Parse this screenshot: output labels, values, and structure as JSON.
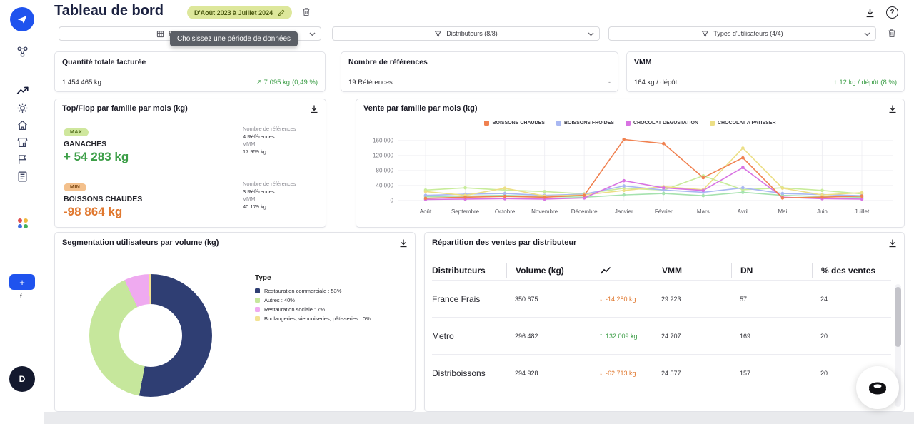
{
  "header": {
    "title": "Tableau de bord",
    "period_badge": "D'Août 2023 à Juillet 2024",
    "help_label": "?"
  },
  "tooltip": "Choisissez une période de données",
  "filters": [
    {
      "label": "Références (19/19)"
    },
    {
      "label": "Distributeurs (8/8)"
    },
    {
      "label": "Types d'utilisateurs (4/4)"
    }
  ],
  "kpis": [
    {
      "title": "Quantité totale facturée",
      "value": "1 454 465 kg",
      "delta_arrow": "↗",
      "delta": "7 095 kg",
      "pct": "(0,49 %)"
    },
    {
      "title": "Nombre de références",
      "value": "19 Références",
      "dash": "-"
    },
    {
      "title": "VMM",
      "value": "164 kg / dépôt",
      "delta_arrow": "↑",
      "delta": "12 kg / dépôt",
      "pct": "(8 %)"
    }
  ],
  "topflop": {
    "title": "Top/Flop par famille par mois (kg)",
    "max": {
      "badge": "MAX",
      "family": "GANACHES",
      "value": "+ 54 283 kg",
      "ref_label": "Nombre de références",
      "ref_value": "4 Références",
      "vmm_label": "VMM",
      "vmm_value": "17 959 kg"
    },
    "min": {
      "badge": "MIN",
      "family": "BOISSONS CHAUDES",
      "value": "-98 864 kg",
      "ref_label": "Nombre de références",
      "ref_value": "3 Références",
      "vmm_label": "VMM",
      "vmm_value": "40 179 kg"
    }
  },
  "chart_data": [
    {
      "type": "line",
      "title": "Vente par famille par mois (kg)",
      "x": [
        "Août",
        "Septembre",
        "Octobre",
        "Novembre",
        "Décembre",
        "Janvier",
        "Février",
        "Mars",
        "Avril",
        "Mai",
        "Juin",
        "Juillet"
      ],
      "ylim": [
        0,
        160000
      ],
      "yticks": [
        0,
        40000,
        80000,
        120000,
        160000
      ],
      "ytick_labels": [
        "0",
        "40 000",
        "80 000",
        "120 000",
        "160 000"
      ],
      "grid": true,
      "legend": [
        "BOISSONS CHAUDES",
        "BOISSONS FROIDES",
        "CHOCOLAT DEGUSTATION",
        "CHOCOLAT A PATISSER"
      ],
      "series": [
        {
          "name": "",
          "color": "#c8ec9b",
          "values": [
            28000,
            34000,
            28000,
            24000,
            18000,
            33000,
            28000,
            66000,
            29000,
            34000,
            27000,
            18000
          ]
        },
        {
          "name": "",
          "color": "#a5e2ae",
          "values": [
            10000,
            12000,
            14000,
            11000,
            9000,
            15000,
            19000,
            13000,
            22000,
            14000,
            11000,
            9000
          ]
        },
        {
          "name": "BOISSONS FROIDES",
          "color": "#a9b8f2",
          "values": [
            14000,
            17000,
            19000,
            14000,
            17000,
            39000,
            28000,
            22000,
            34000,
            19000,
            16000,
            13000
          ]
        },
        {
          "name": "CHOCOLAT A PATISSER",
          "color": "#ecdf86",
          "values": [
            24000,
            14000,
            33000,
            12000,
            15000,
            27000,
            37000,
            29000,
            140000,
            33000,
            15000,
            21000
          ]
        },
        {
          "name": "CHOCOLAT DEGUSTATION",
          "color": "#d873e2",
          "values": [
            3000,
            4000,
            5000,
            4000,
            7000,
            53000,
            34000,
            27000,
            88000,
            9000,
            5000,
            4000
          ]
        },
        {
          "name": "BOISSONS CHAUDES",
          "color": "#f08150",
          "values": [
            6000,
            9000,
            11000,
            9000,
            14000,
            163000,
            152000,
            61000,
            114000,
            7000,
            9000,
            12000
          ]
        }
      ]
    },
    {
      "type": "pie",
      "title": "Segmentation utilisateurs par volume (kg)",
      "legend_title": "Type",
      "slices": [
        {
          "label": "Restauration commerciale",
          "pct": 53,
          "sweep": 53,
          "color": "#2f3e73",
          "legend_text": "Restauration commerciale : 53%"
        },
        {
          "label": "Autres",
          "pct": 40,
          "sweep": 40,
          "color": "#c6e79c",
          "legend_text": "Autres : 40%"
        },
        {
          "label": "Restauration sociale",
          "pct": 7,
          "sweep": 6.5,
          "color": "#efaaf0",
          "legend_text": "Restauration sociale : 7%"
        },
        {
          "label": "Boulangeries, viennoiseries, pâtisseries",
          "pct": 0,
          "sweep": 0.5,
          "color": "#f3e394",
          "legend_text": "Boulangeries, viennoiseries, pâtisseries : 0%"
        }
      ]
    }
  ],
  "distributor_table": {
    "title": "Répartition des ventes par distributeur",
    "columns": [
      "Distributeurs",
      "Volume (kg)",
      "",
      "VMM",
      "DN",
      "% des ventes"
    ],
    "rows": [
      {
        "name": "France Frais",
        "volume": "350 675",
        "trend_dir": "down",
        "trend_value": "-14 280 kg",
        "vmm": "29 223",
        "dn": "57",
        "pct": "24"
      },
      {
        "name": "Metro",
        "volume": "296 482",
        "trend_dir": "up",
        "trend_value": "132 009 kg",
        "vmm": "24 707",
        "dn": "169",
        "pct": "20"
      },
      {
        "name": "Distriboissons",
        "volume": "294 928",
        "trend_dir": "down",
        "trend_value": "-62 713 kg",
        "vmm": "24 577",
        "dn": "157",
        "pct": "20"
      }
    ]
  },
  "sidebar": {
    "avatar_label": "D",
    "add_label": "+",
    "footer_text": "f."
  }
}
